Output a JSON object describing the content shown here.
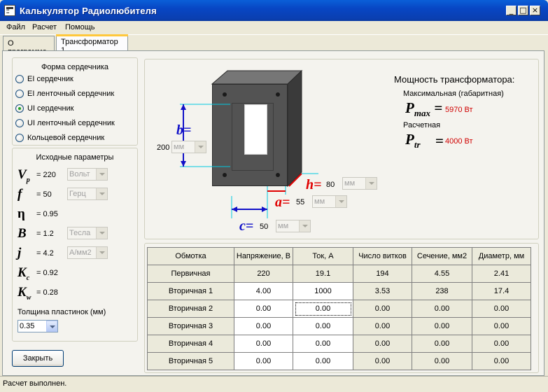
{
  "window": {
    "title": "Калькулятор Радиолюбителя"
  },
  "titlebar_buttons": {
    "minimize": "_",
    "maximize": "□",
    "close": "×"
  },
  "menu": [
    "Файл",
    "Расчет",
    "Помощь"
  ],
  "tabs": [
    {
      "label": "О программе",
      "active": false
    },
    {
      "label": "Трансформатор 1",
      "active": true
    }
  ],
  "core_shape": {
    "title": "Форма сердечника",
    "options": [
      {
        "label": "EI сердечник",
        "selected": false
      },
      {
        "label": "EI ленточный сердечник",
        "selected": false
      },
      {
        "label": "UI сердечник",
        "selected": true
      },
      {
        "label": "UI ленточный сердечник",
        "selected": false
      },
      {
        "label": "Кольцевой сердечник",
        "selected": false
      }
    ]
  },
  "params": {
    "title": "Исходные параметры",
    "items": [
      {
        "sym": "V",
        "sub": "p",
        "eq": "=",
        "value": "220",
        "unit": "Вольт"
      },
      {
        "sym": "f",
        "sub": "",
        "eq": "=",
        "value": "50",
        "unit": "Герц"
      },
      {
        "sym": "η",
        "sub": "",
        "eq": "=",
        "value": "0.95",
        "unit": ""
      },
      {
        "sym": "B",
        "sub": "",
        "eq": "=",
        "value": "1.2",
        "unit": "Тесла"
      },
      {
        "sym": "j",
        "sub": "",
        "eq": "=",
        "value": "4.2",
        "unit": "А/мм2"
      },
      {
        "sym": "K",
        "sub": "c",
        "eq": "=",
        "value": "0.92",
        "unit": ""
      },
      {
        "sym": "K",
        "sub": "w",
        "eq": "=",
        "value": "0.28",
        "unit": ""
      }
    ],
    "thickness_label": "Толщина пластинок (мм)",
    "thickness_value": "0.35"
  },
  "close_button": "Закрыть",
  "dimensions": {
    "b": {
      "label": "b",
      "eq": "=",
      "value": "200",
      "unit": "мм"
    },
    "h": {
      "label": "h",
      "eq": "=",
      "value": "80",
      "unit": "мм"
    },
    "a": {
      "label": "a",
      "eq": "=",
      "value": "55",
      "unit": "мм"
    },
    "c": {
      "label": "c",
      "eq": "=",
      "value": "50",
      "unit": "мм"
    }
  },
  "power": {
    "title": "Мощность трансформатора:",
    "max_label": "Максимальная (габаритная)",
    "max_sym": "P",
    "max_sub": "max",
    "max_eq": "=",
    "max_value": "5970 Вт",
    "calc_label": "Расчетная",
    "calc_sym": "P",
    "calc_sub": "tr",
    "calc_eq": "=",
    "calc_value": "4000 Вт"
  },
  "table": {
    "headers": [
      "Обмотка",
      "Напряжение, В",
      "Ток, А",
      "Число витков",
      "Сечение, мм2",
      "Диаметр, мм"
    ],
    "rows": [
      [
        "Первичная",
        "220",
        "19.1",
        "194",
        "4.55",
        "2.41"
      ],
      [
        "Вторичная 1",
        "4.00",
        "1000",
        "3.53",
        "238",
        "17.4"
      ],
      [
        "Вторичная 2",
        "0.00",
        "0.00",
        "0.00",
        "0.00",
        "0.00"
      ],
      [
        "Вторичная 3",
        "0.00",
        "0.00",
        "0.00",
        "0.00",
        "0.00"
      ],
      [
        "Вторичная 4",
        "0.00",
        "0.00",
        "0.00",
        "0.00",
        "0.00"
      ],
      [
        "Вторичная 5",
        "0.00",
        "0.00",
        "0.00",
        "0.00",
        "0.00"
      ]
    ]
  },
  "status": "Расчет выполнен.",
  "colors": {
    "dim_blue": "#1010c8",
    "dim_red": "#e00000",
    "power_red": "#d00000",
    "cyan_guides": "#00c8e0"
  }
}
